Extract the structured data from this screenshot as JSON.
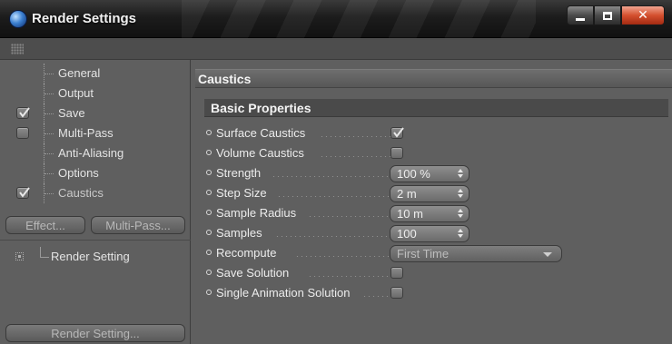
{
  "window": {
    "title": "Render Settings",
    "controls": {
      "minimize": "minimize",
      "maximize": "maximize",
      "close": "close"
    }
  },
  "sidebar": {
    "items": [
      {
        "label": "General",
        "checkbox": false,
        "checked": false
      },
      {
        "label": "Output",
        "checkbox": false,
        "checked": false
      },
      {
        "label": "Save",
        "checkbox": true,
        "checked": true
      },
      {
        "label": "Multi-Pass",
        "checkbox": true,
        "checked": false
      },
      {
        "label": "Anti-Aliasing",
        "checkbox": false,
        "checked": false
      },
      {
        "label": "Options",
        "checkbox": false,
        "checked": false
      },
      {
        "label": "Caustics",
        "checkbox": true,
        "checked": true,
        "active": true
      }
    ],
    "effect_button": "Effect...",
    "multipass_button": "Multi-Pass...",
    "render_setting_item": "Render Setting",
    "render_setting_button": "Render Setting..."
  },
  "main": {
    "section_title": "Caustics",
    "group_title": "Basic Properties",
    "properties": {
      "surface_caustics": {
        "label": "Surface Caustics",
        "checked": true
      },
      "volume_caustics": {
        "label": "Volume Caustics",
        "checked": false
      },
      "strength": {
        "label": "Strength",
        "value": "100 %"
      },
      "step_size": {
        "label": "Step Size",
        "value": "2 m"
      },
      "sample_radius": {
        "label": "Sample Radius",
        "value": "10 m"
      },
      "samples": {
        "label": "Samples",
        "value": "100"
      },
      "recompute": {
        "label": "Recompute",
        "value": "First Time"
      },
      "save_solution": {
        "label": "Save Solution",
        "checked": false
      },
      "single_animation_solution": {
        "label": "Single Animation Solution",
        "checked": false
      }
    }
  },
  "colors": {
    "background": "#5f5f5f",
    "titlebar": "#1c1c1c",
    "close_button": "#d4502e",
    "group_header": "#4a4a4a"
  }
}
